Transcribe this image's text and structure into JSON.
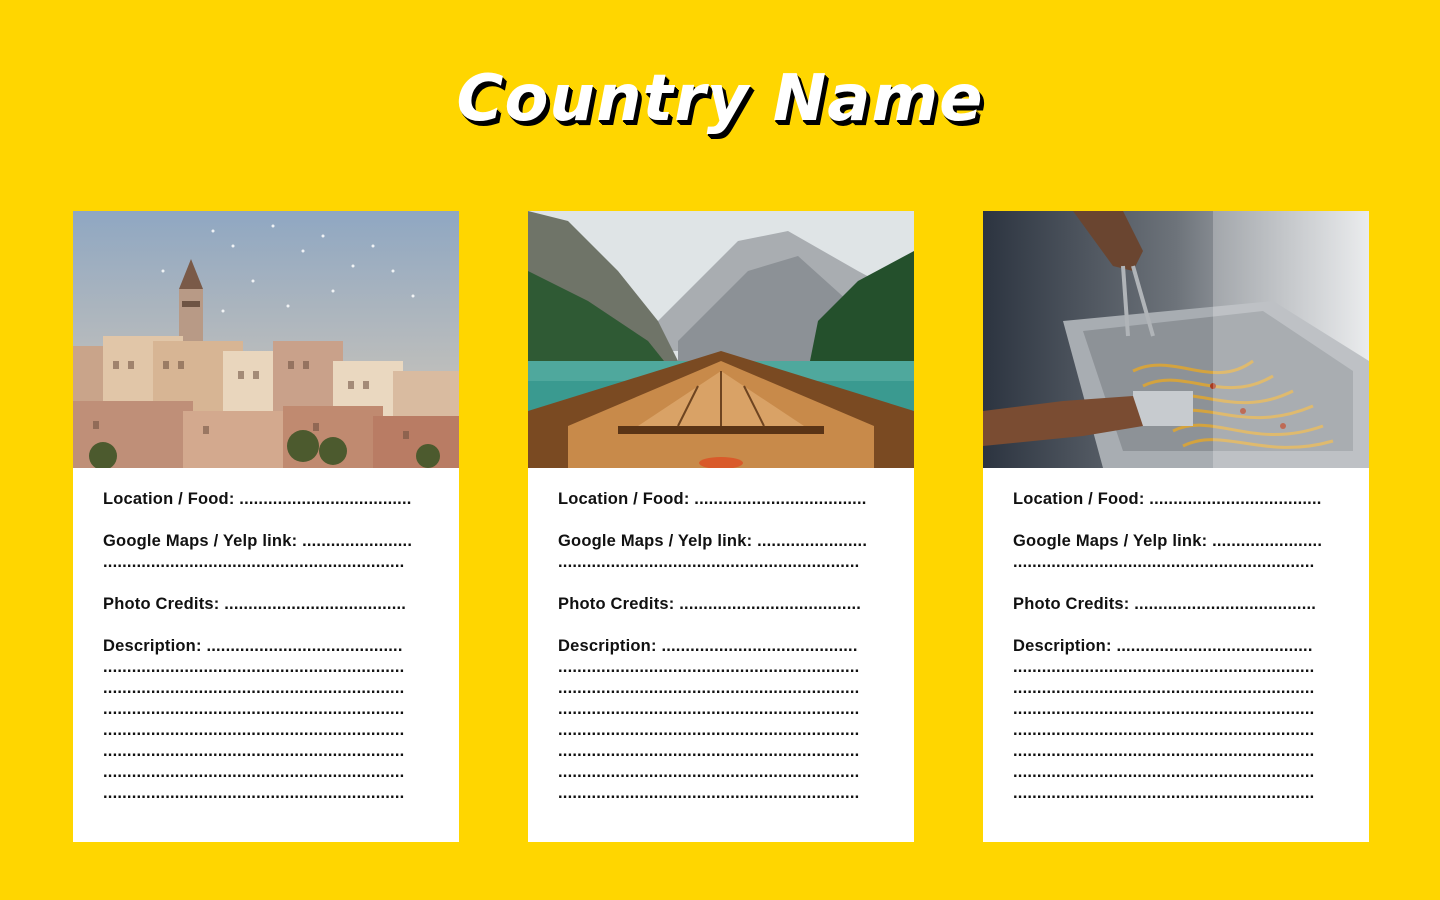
{
  "page": {
    "title": "Country Name",
    "colors": {
      "background": "#FFD600",
      "card": "#FFFFFF",
      "text": "#111111"
    }
  },
  "cards": [
    {
      "image": "istanbul-galata-tower-cityscape",
      "location_label": "Location / Food: ....................................",
      "maps_label": "Google Maps / Yelp link: .......................",
      "maps_continuation": "...............................................................",
      "credits_label": "Photo Credits: ......................................",
      "description_label": "Description: .........................................",
      "description_lines": [
        "...............................................................",
        "...............................................................",
        "...............................................................",
        "...............................................................",
        "...............................................................",
        "...............................................................",
        "..............................................................."
      ]
    },
    {
      "image": "boat-bow-on-mountain-lake",
      "location_label": "Location / Food: ....................................",
      "maps_label": "Google Maps / Yelp link: .......................",
      "maps_continuation": "...............................................................",
      "credits_label": "Photo Credits: ......................................",
      "description_label": "Description: .........................................",
      "description_lines": [
        "...............................................................",
        "...............................................................",
        "...............................................................",
        "...............................................................",
        "...............................................................",
        "...............................................................",
        "..............................................................."
      ]
    },
    {
      "image": "street-food-noodles-stall",
      "location_label": "Location / Food: ....................................",
      "maps_label": "Google Maps / Yelp link: .......................",
      "maps_continuation": "...............................................................",
      "credits_label": "Photo Credits: ......................................",
      "description_label": "Description: .........................................",
      "description_lines": [
        "...............................................................",
        "...............................................................",
        "...............................................................",
        "...............................................................",
        "...............................................................",
        "...............................................................",
        "..............................................................."
      ]
    }
  ]
}
